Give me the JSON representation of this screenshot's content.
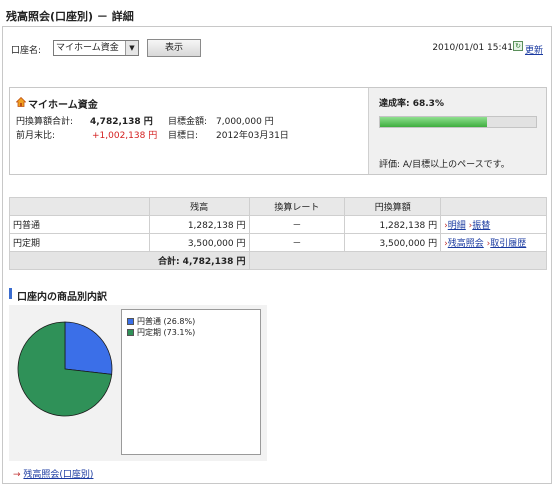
{
  "page": {
    "title": "残高照会(口座別) － 詳細"
  },
  "filter": {
    "account_label": "口座名:",
    "account_selected": "マイホーム資金",
    "show_button": "表示",
    "timestamp": "2010/01/01 15:41",
    "refresh_label": "更新"
  },
  "goal": {
    "name": "マイホーム資金",
    "total_label": "円換算額合計:",
    "total_value": "4,782,138 円",
    "target_amount_label": "目標金額:",
    "target_amount_value": "7,000,000 円",
    "vs_prev_label": "前月末比:",
    "vs_prev_value": "+1,002,138 円",
    "target_date_label": "目標日:",
    "target_date_value": "2012年03月31日",
    "rate_label": "達成率: 68.3%",
    "rate_value": 0.683,
    "evaluation": "評価: A/目標以上のペースです。"
  },
  "table": {
    "headers": [
      "",
      "残高",
      "換算レート",
      "円換算額",
      ""
    ],
    "rows": [
      {
        "name": "円普通",
        "balance": "1,282,138 円",
        "rate": "－",
        "yen": "1,282,138 円",
        "link1": "明細",
        "link2": "振替"
      },
      {
        "name": "円定期",
        "balance": "3,500,000 円",
        "rate": "－",
        "yen": "3,500,000 円",
        "link1": "残高照会",
        "link2": "取引履歴"
      }
    ],
    "total": "合計: 4,782,138 円"
  },
  "breakdown": {
    "title": "口座内の商品別内訳",
    "legend": [
      {
        "label": "円普通 (26.8%)",
        "color": "#3b6fe8"
      },
      {
        "label": "円定期 (73.1%)",
        "color": "#2f9158"
      }
    ]
  },
  "chart_data": {
    "type": "pie",
    "categories": [
      "円普通",
      "円定期"
    ],
    "values": [
      26.8,
      73.1
    ],
    "colors": [
      "#3b6fe8",
      "#2f9158"
    ]
  },
  "footer": {
    "back_link": "残高照会(口座別)"
  }
}
